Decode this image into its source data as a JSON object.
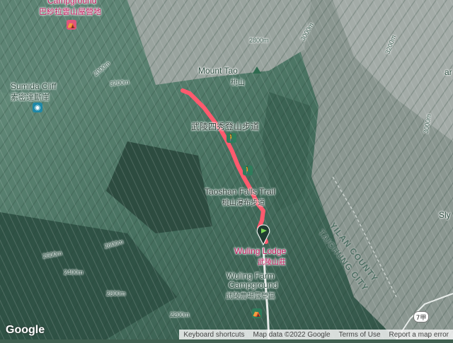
{
  "map": {
    "labels": {
      "campground_top": "Campground",
      "campground_top_zh": "巴紗拉雲山屋營地",
      "sumida_cliff": "Sumida Cliff",
      "sumida_cliff_zh": "素密達斷崖",
      "mount_tao": "Mount Tao",
      "mount_tao_zh": "桃山",
      "wuling_trail_zh": "武陵四秀登山步道",
      "taoshan_falls": "Taoshan Falls Trail",
      "taoshan_falls_zh": "桃山瀑布步道",
      "wuling_lodge": "Wuling Lodge",
      "wuling_lodge_zh": "武陵山莊",
      "wuling_farm": "Wuling Farm",
      "wuling_farm_2": "Campground",
      "wuling_farm_zh": "武陵農場露營區",
      "yilan_county": "YILAN COUNTY",
      "taichung_city": "TAICHUNG CITY",
      "edge_right": "Sly",
      "road_shield": "7甲"
    },
    "contours": [
      "3200m",
      "3000m",
      "2800m",
      "2600m",
      "2400m",
      "2200m",
      "2000m",
      "3200m",
      "3000m",
      "2800m",
      "2600m"
    ],
    "track_color": "#ff5a6e",
    "footer": {
      "shortcuts": "Keyboard shortcuts",
      "map_data": "Map data ©2022 Google",
      "terms": "Terms of Use",
      "report": "Report a map error"
    },
    "logo": "Google"
  }
}
